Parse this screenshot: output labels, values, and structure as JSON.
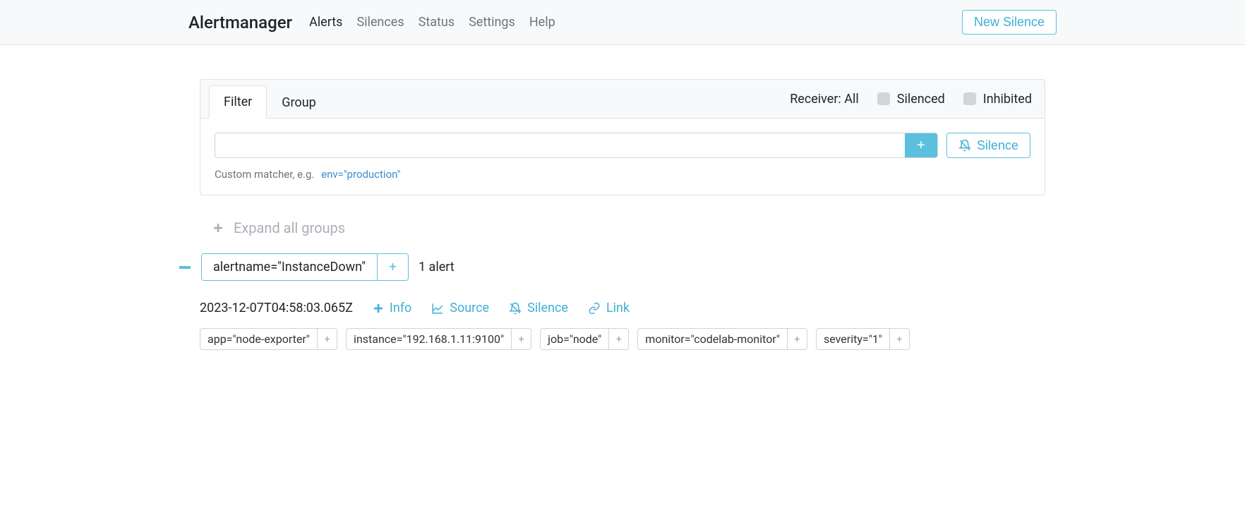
{
  "nav": {
    "brand": "Alertmanager",
    "links": [
      "Alerts",
      "Silences",
      "Status",
      "Settings",
      "Help"
    ],
    "active": 0,
    "new_silence": "New Silence"
  },
  "filter_card": {
    "tabs": [
      "Filter",
      "Group"
    ],
    "active_tab": 0,
    "receiver_label": "Receiver: All",
    "silenced_label": "Silenced",
    "inhibited_label": "Inhibited",
    "input_value": "",
    "add_label": "+",
    "silence_btn": "Silence",
    "helper_prefix": "Custom matcher, e.g.",
    "helper_example": "env=\"production\""
  },
  "expand_all": "Expand all groups",
  "group": {
    "tag": "alertname=\"InstanceDown\"",
    "count": "1 alert"
  },
  "alert": {
    "timestamp": "2023-12-07T04:58:03.065Z",
    "info": "Info",
    "source": "Source",
    "silence": "Silence",
    "link": "Link",
    "labels": [
      "app=\"node-exporter\"",
      "instance=\"192.168.1.11:9100\"",
      "job=\"node\"",
      "monitor=\"codelab-monitor\"",
      "severity=\"1\""
    ]
  }
}
